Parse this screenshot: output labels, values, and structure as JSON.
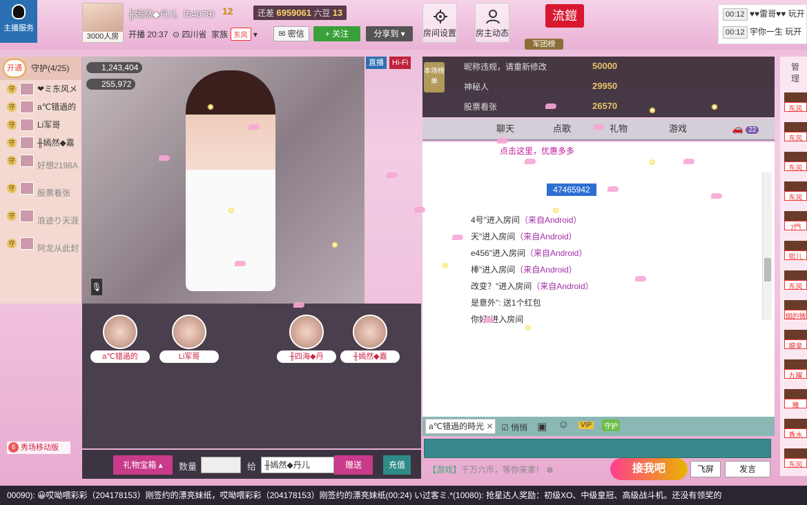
{
  "host_service": {
    "label": "主播服务"
  },
  "room": {
    "audience": "3000人房",
    "host_name": "╫嫣然◆丹儿（54078）",
    "host_level": "12",
    "beans_prefix": "还差",
    "beans_value": "6959061",
    "beans_suffix": "六豆",
    "next_level": "13",
    "start_time": "开播 20:37",
    "location": "四川省",
    "family_label": "家族",
    "family_tag": "东风",
    "msg_btn": "密信",
    "follow_btn": "+ 关注",
    "share_btn": "分享到"
  },
  "toolbar": {
    "room_settings": "房间设置",
    "host_activity": "房主动态",
    "group_badge": "流鎧",
    "army_roll": "军团榜"
  },
  "clocks": [
    {
      "time": "00:12",
      "text": "♥♥雷哥♥♥ 玩开"
    },
    {
      "time": "00:12",
      "text": "宇你一生 玩开"
    }
  ],
  "guard": {
    "open": "开通",
    "title": "守护(4/25)",
    "items": [
      "❤ミ东风メ",
      "a℃错過的",
      "Li军哥",
      "╫嫣然◆嘉",
      "好想2198A",
      "股票看张",
      "浪迹り天涯",
      "阿龙从此封"
    ]
  },
  "video": {
    "wealth1": "1,243,404",
    "wealth2": "255,972",
    "live_tag": "直播",
    "hifi_tag": "Hi-Fi"
  },
  "seats": [
    "a℃错過的",
    "Li军哥",
    "╫四海◆丹",
    "╫嫣然◆嘉"
  ],
  "gift": {
    "box": "礼物宝箱",
    "qty_label": "数量",
    "to_label": "给",
    "recipient": "╫嫣然◆丹儿",
    "send": "赠送",
    "recharge": "充值"
  },
  "rank": {
    "tag": "本场榜单",
    "rows": [
      {
        "name": "昵称违规，请重新修改",
        "score": "50000"
      },
      {
        "name": "神秘人",
        "score": "29950"
      },
      {
        "name": "股票看张",
        "score": "26570"
      }
    ]
  },
  "tabs": [
    "聊天",
    "点歌",
    "礼物",
    "游戏",
    "22"
  ],
  "chat": {
    "promo": "点击这里，优惠多多",
    "id": "47465942",
    "messages": [
      {
        "text": "4号\"进入房间",
        "src": "（来自Android）"
      },
      {
        "text": "天\"进入房间",
        "src": "（来自Android）"
      },
      {
        "text": "e456\"进入房间",
        "src": "（来自Android）"
      },
      {
        "text": "棒\"进入房间",
        "src": "（来自Android）"
      },
      {
        "text": "改变？\"进入房间",
        "src": "（来自Android）"
      },
      {
        "text": "是意外\": 送1个红包",
        "src": ""
      },
      {
        "text": "你好\"进入房间",
        "src": ""
      }
    ]
  },
  "compose": {
    "recipient": "a℃错過的時光",
    "quiet": "悄悄",
    "ad_prefix": "【游戏】",
    "ad_text": "千万六币，等你来拿！",
    "catch": "接我吧",
    "flyscreen": "飞屏",
    "send": "发言"
  },
  "right_strip": {
    "manage": "管理",
    "tags": [
      "东风",
      "东风",
      "东风",
      "东风",
      "7門",
      "熙儿",
      "东风",
      "烟的微",
      "龍皇",
      "九曜",
      "雅",
      "香水",
      "东风"
    ]
  },
  "mobile": "秀场移动版",
  "ticker": "00090): 😀哎呦喂彩彩（204178153）刚签约的漂亮妹纸，哎呦喂彩彩（204178153）刚签约的漂亮妹纸(00:24)     い过客ミ.*(10080): 抢星达人奖励：初级XO、中级皇冠、高级战斗机。还没有领奖的"
}
